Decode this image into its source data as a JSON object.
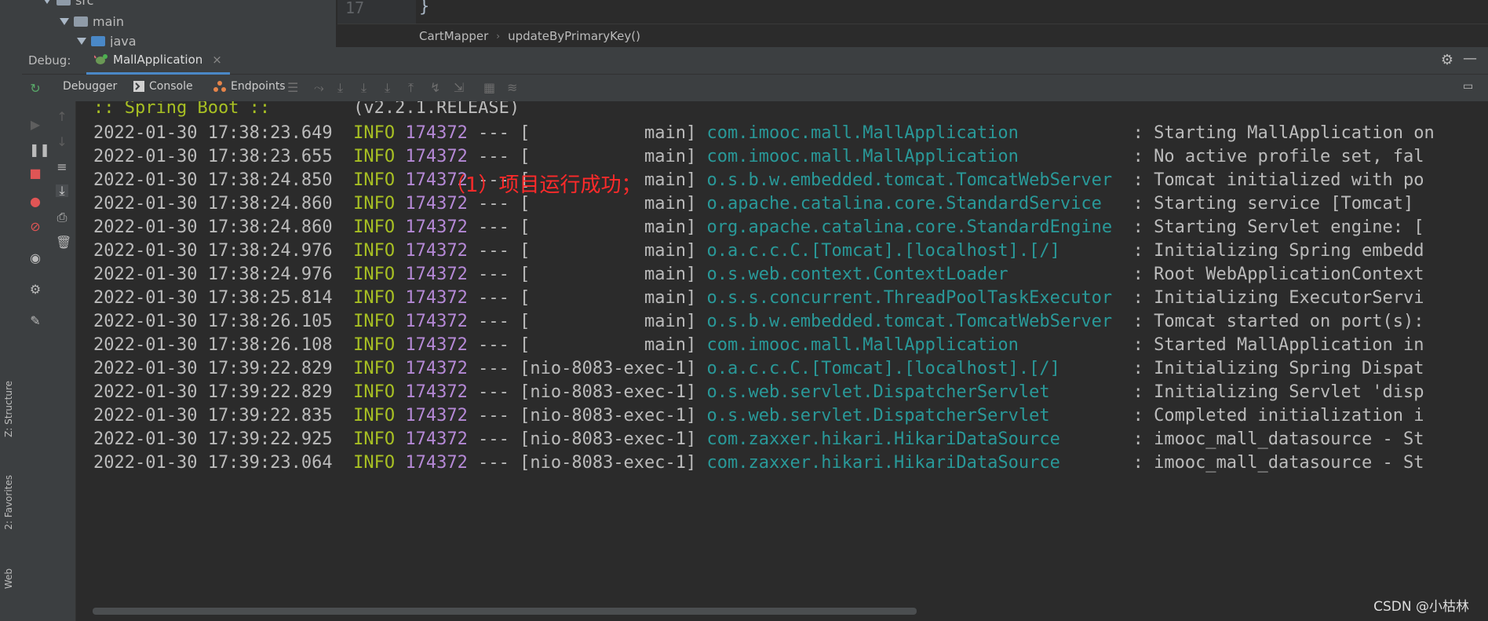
{
  "project_tree": {
    "items": [
      {
        "label": "src"
      },
      {
        "label": "main"
      },
      {
        "label": "java"
      }
    ]
  },
  "editor": {
    "line_number": "17",
    "line_text": "}",
    "breadcrumb": [
      "CartMapper",
      "updateByPrimaryKey()"
    ]
  },
  "debug": {
    "label": "Debug:",
    "tab": "MallApplication",
    "toolbar": {
      "debugger": "Debugger",
      "console": "Console",
      "endpoints": "Endpoints"
    }
  },
  "left_stripe": {
    "structure": "Z: Structure",
    "favorites": "2: Favorites",
    "web": "Web"
  },
  "console": {
    "banner_tag": ":: Spring Boot ::",
    "banner_version": "(v2.2.1.RELEASE)",
    "annotation": "（1）项目运行成功；",
    "lines": [
      {
        "ts": "2022-01-30 17:38:23.649",
        "level": "INFO",
        "pid": "174372",
        "thread": "[           main]",
        "logger": "com.imooc.mall.MallApplication          ",
        "msg": ": Starting MallApplication on"
      },
      {
        "ts": "2022-01-30 17:38:23.655",
        "level": "INFO",
        "pid": "174372",
        "thread": "[           main]",
        "logger": "com.imooc.mall.MallApplication          ",
        "msg": ": No active profile set, fal"
      },
      {
        "ts": "2022-01-30 17:38:24.850",
        "level": "INFO",
        "pid": "174372",
        "thread": "[           main]",
        "logger": "o.s.b.w.embedded.tomcat.TomcatWebServer ",
        "msg": ": Tomcat initialized with po"
      },
      {
        "ts": "2022-01-30 17:38:24.860",
        "level": "INFO",
        "pid": "174372",
        "thread": "[           main]",
        "logger": "o.apache.catalina.core.StandardService  ",
        "msg": ": Starting service [Tomcat]"
      },
      {
        "ts": "2022-01-30 17:38:24.860",
        "level": "INFO",
        "pid": "174372",
        "thread": "[           main]",
        "logger": "org.apache.catalina.core.StandardEngine ",
        "msg": ": Starting Servlet engine: ["
      },
      {
        "ts": "2022-01-30 17:38:24.976",
        "level": "INFO",
        "pid": "174372",
        "thread": "[           main]",
        "logger": "o.a.c.c.C.[Tomcat].[localhost].[/]      ",
        "msg": ": Initializing Spring embedd"
      },
      {
        "ts": "2022-01-30 17:38:24.976",
        "level": "INFO",
        "pid": "174372",
        "thread": "[           main]",
        "logger": "o.s.web.context.ContextLoader           ",
        "msg": ": Root WebApplicationContext"
      },
      {
        "ts": "2022-01-30 17:38:25.814",
        "level": "INFO",
        "pid": "174372",
        "thread": "[           main]",
        "logger": "o.s.s.concurrent.ThreadPoolTaskExecutor ",
        "msg": ": Initializing ExecutorServi"
      },
      {
        "ts": "2022-01-30 17:38:26.105",
        "level": "INFO",
        "pid": "174372",
        "thread": "[           main]",
        "logger": "o.s.b.w.embedded.tomcat.TomcatWebServer ",
        "msg": ": Tomcat started on port(s):"
      },
      {
        "ts": "2022-01-30 17:38:26.108",
        "level": "INFO",
        "pid": "174372",
        "thread": "[           main]",
        "logger": "com.imooc.mall.MallApplication          ",
        "msg": ": Started MallApplication in"
      },
      {
        "ts": "2022-01-30 17:39:22.829",
        "level": "INFO",
        "pid": "174372",
        "thread": "[nio-8083-exec-1]",
        "logger": "o.a.c.c.C.[Tomcat].[localhost].[/]      ",
        "msg": ": Initializing Spring Dispat"
      },
      {
        "ts": "2022-01-30 17:39:22.829",
        "level": "INFO",
        "pid": "174372",
        "thread": "[nio-8083-exec-1]",
        "logger": "o.s.web.servlet.DispatcherServlet       ",
        "msg": ": Initializing Servlet 'disp"
      },
      {
        "ts": "2022-01-30 17:39:22.835",
        "level": "INFO",
        "pid": "174372",
        "thread": "[nio-8083-exec-1]",
        "logger": "o.s.web.servlet.DispatcherServlet       ",
        "msg": ": Completed initialization i"
      },
      {
        "ts": "2022-01-30 17:39:22.925",
        "level": "INFO",
        "pid": "174372",
        "thread": "[nio-8083-exec-1]",
        "logger": "com.zaxxer.hikari.HikariDataSource      ",
        "msg": ": imooc_mall_datasource - St"
      },
      {
        "ts": "2022-01-30 17:39:23.064",
        "level": "INFO",
        "pid": "174372",
        "thread": "[nio-8083-exec-1]",
        "logger": "com.zaxxer.hikari.HikariDataSource      ",
        "msg": ": imooc_mall_datasource - St"
      }
    ]
  },
  "watermark": "CSDN @小枯林",
  "colors": {
    "info": "#a8c023",
    "pid": "#b589d6",
    "logger": "#299999",
    "annotation": "#ff2a2a",
    "accent": "#4a88c7"
  }
}
